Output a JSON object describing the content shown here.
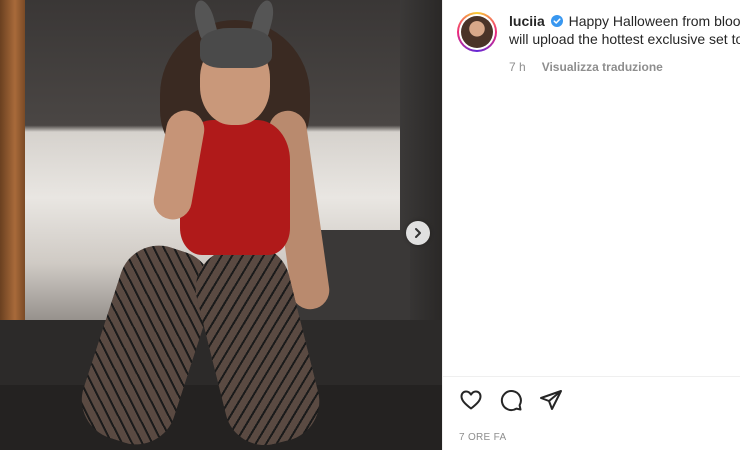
{
  "post": {
    "username": "luciia",
    "caption_line1": "Happy Halloween from blood",
    "caption_line2": "will upload the hottest exclusive set to",
    "time_ago": "7 h",
    "translate_label": "Visualizza traduzione",
    "timestamp": "7 ORE FA"
  },
  "icons": {
    "verified": "verified-badge-icon",
    "next": "chevron-right-icon",
    "like": "heart-icon",
    "comment": "comment-icon",
    "share": "send-icon"
  },
  "colors": {
    "verified": "#3897f0",
    "muted_text": "#8e8e8e",
    "text": "#262626"
  }
}
